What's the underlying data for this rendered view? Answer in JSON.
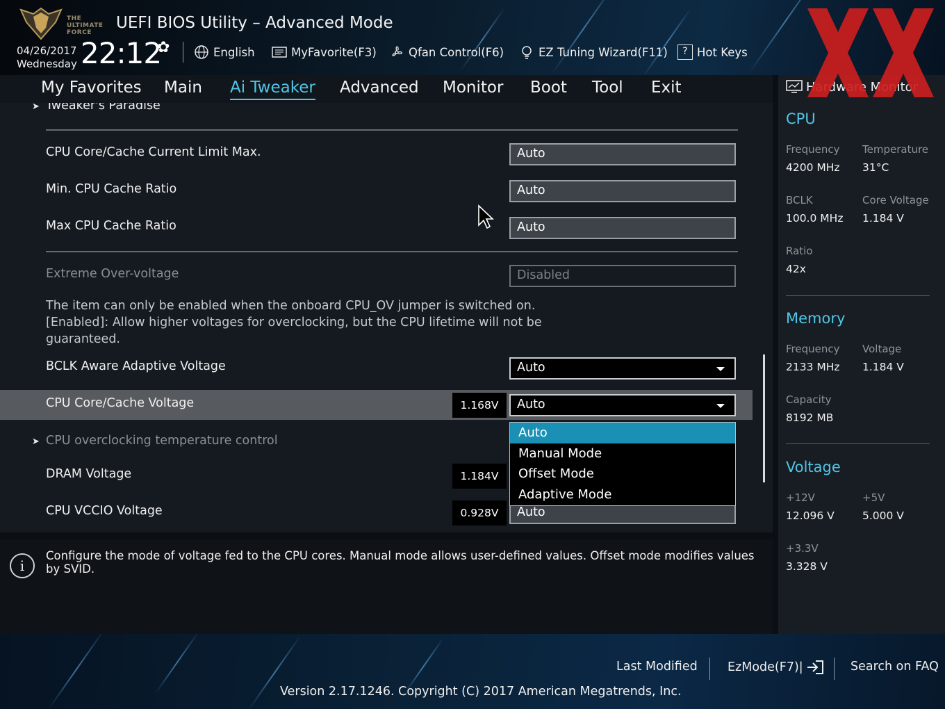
{
  "header": {
    "brand_logo_text": "THE ULTIMATE FORCE",
    "title": "UEFI BIOS Utility – Advanced Mode",
    "date": "04/26/2017",
    "weekday": "Wednesday",
    "time": "22:12",
    "buttons": [
      {
        "label": "English",
        "icon": "globe-icon"
      },
      {
        "label": "MyFavorite(F3)",
        "icon": "favorite-list-icon"
      },
      {
        "label": "Qfan Control(F6)",
        "icon": "fan-icon"
      },
      {
        "label": "EZ Tuning Wizard(F11)",
        "icon": "lightbulb-icon"
      },
      {
        "label": "Hot Keys",
        "icon": "question-icon"
      }
    ],
    "watermark": "XX"
  },
  "menu": {
    "items": [
      "My Favorites",
      "Main",
      "Ai Tweaker",
      "Advanced",
      "Monitor",
      "Boot",
      "Tool",
      "Exit"
    ],
    "active": "Ai Tweaker"
  },
  "content": {
    "top_partial": "Tweaker's Paradise",
    "rows": [
      {
        "label": "CPU Core/Cache Current Limit Max.",
        "value": "Auto"
      },
      {
        "label": "Min. CPU Cache Ratio",
        "value": "Auto"
      },
      {
        "label": "Max CPU Cache Ratio",
        "value": "Auto"
      },
      {
        "label": "Extreme Over-voltage",
        "value": "Disabled"
      }
    ],
    "description": "The item can only be enabled when the onboard CPU_OV jumper is switched on. [Enabled]: Allow higher voltages for overclocking, but the CPU lifetime will not be guaranteed.",
    "bclk": {
      "label": "BCLK Aware Adaptive Voltage",
      "value": "Auto"
    },
    "core_voltage": {
      "label": "CPU Core/Cache Voltage",
      "reading": "1.168V",
      "value": "Auto"
    },
    "oc_temp": {
      "label": "CPU overclocking temperature control"
    },
    "dram": {
      "label": "DRAM Voltage",
      "reading": "1.184V"
    },
    "vccio": {
      "label": "CPU VCCIO Voltage",
      "reading": "0.928V",
      "value": "Auto"
    },
    "dropdown": {
      "options": [
        "Auto",
        "Manual Mode",
        "Offset Mode",
        "Adaptive Mode"
      ],
      "selected": "Auto"
    }
  },
  "info": {
    "text": "Configure the mode of voltage fed to the CPU cores. Manual mode allows user-defined values. Offset mode modifies values by SVID."
  },
  "hw_monitor": {
    "title": "Hardware Monitor",
    "cpu": {
      "heading": "CPU",
      "frequency_label": "Frequency",
      "frequency": "4200 MHz",
      "temperature_label": "Temperature",
      "temperature": "31°C",
      "bclk_label": "BCLK",
      "bclk": "100.0 MHz",
      "core_voltage_label": "Core Voltage",
      "core_voltage": "1.184 V",
      "ratio_label": "Ratio",
      "ratio": "42x"
    },
    "memory": {
      "heading": "Memory",
      "frequency_label": "Frequency",
      "frequency": "2133 MHz",
      "voltage_label": "Voltage",
      "voltage": "1.184 V",
      "capacity_label": "Capacity",
      "capacity": "8192 MB"
    },
    "voltage": {
      "heading": "Voltage",
      "v12_label": "+12V",
      "v12": "12.096 V",
      "v5_label": "+5V",
      "v5": "5.000 V",
      "v33_label": "+3.3V",
      "v33": "3.328 V"
    }
  },
  "footer": {
    "last_modified": "Last Modified",
    "ezmode": "EzMode(F7)|",
    "search_faq": "Search on FAQ",
    "version": "Version 2.17.1246. Copyright (C) 2017 American Megatrends, Inc."
  },
  "colors": {
    "accent": "#4fc6e8",
    "dropdown_selected": "#1a90b4",
    "highlight_row": "#575b5f",
    "watermark": "#cc1f1f"
  }
}
